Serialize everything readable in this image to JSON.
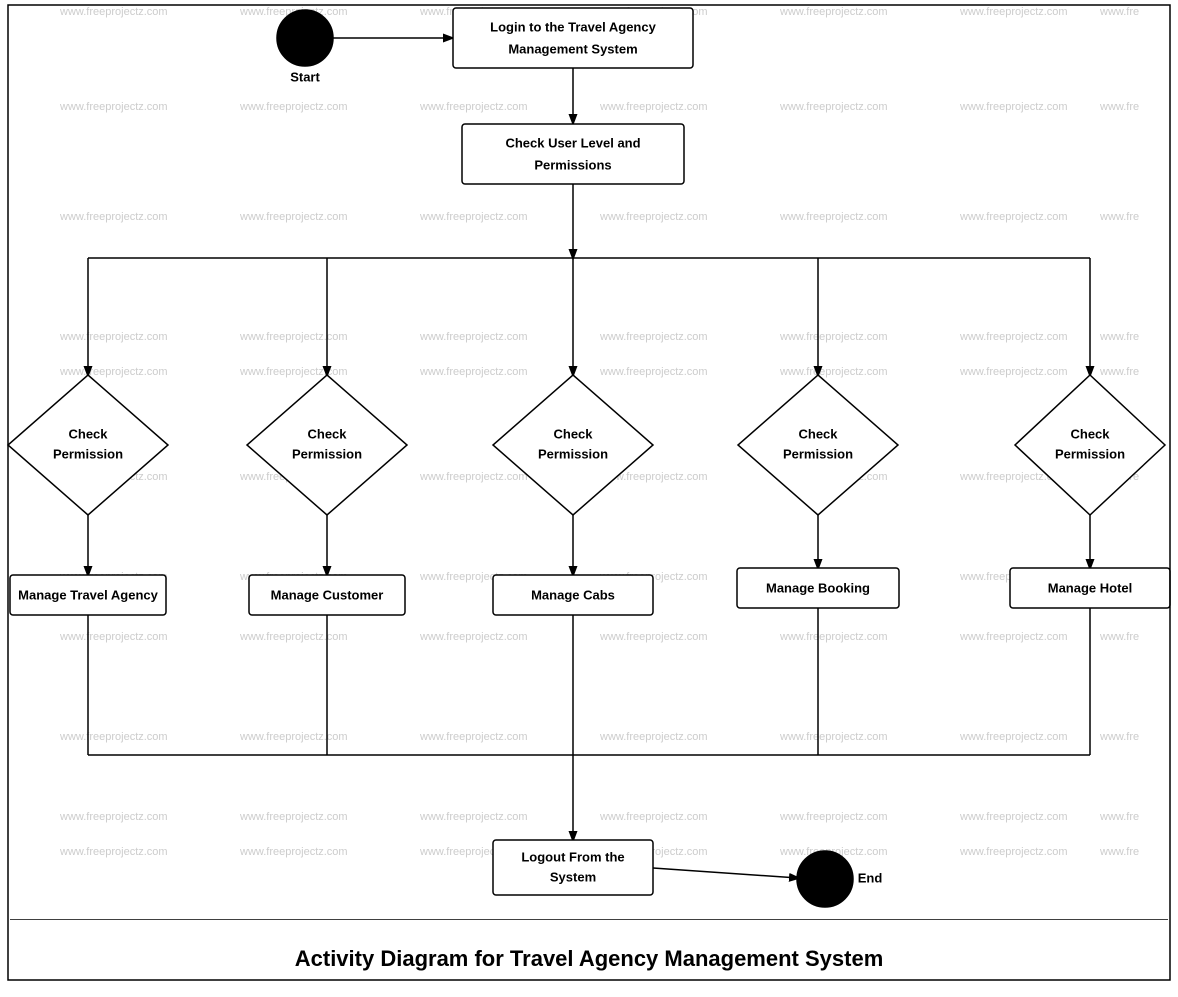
{
  "diagram": {
    "title": "Activity Diagram for Travel Agency Management System",
    "nodes": {
      "start_label": "Start",
      "login": "Login to the Travel Agency\nManagement System",
      "check_permissions": "Check User Level and\nPermissions",
      "check_perm_1": "Check\nPermission",
      "check_perm_2": "Check\nPermission",
      "check_perm_3": "Check\nPermission",
      "check_perm_4": "Check\nPermission",
      "check_perm_5": "Check\nPermission",
      "manage_travel": "Manage Travel Agency",
      "manage_customer": "Manage Customer",
      "manage_cabs": "Manage Cabs",
      "manage_booking": "Manage Booking",
      "manage_hotel": "Manage Hotel",
      "logout": "Logout From the\nSystem",
      "end_label": "End"
    },
    "watermarks": [
      "www.freeprojectz.com"
    ]
  }
}
